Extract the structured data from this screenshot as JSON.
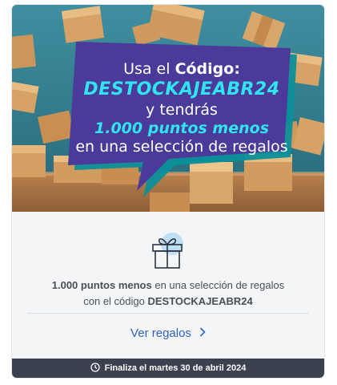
{
  "banner": {
    "line1_prefix": "Usa el ",
    "line1_bold": "Código:",
    "code": "DESTOCKAJEABR24",
    "line3": "y tendrás",
    "points": "1.000 puntos menos",
    "line5": "en una selección de regalos"
  },
  "content": {
    "desc_bold1": "1.000 puntos menos",
    "desc_text1": " en una selección de regalos",
    "desc_text2": "con el código ",
    "desc_bold2": "DESTOCKAJEABR24",
    "link_label": "Ver regalos"
  },
  "footer": {
    "text": "Finaliza el martes 30 de abril 2024"
  },
  "colors": {
    "bubble": "#4b3a9a",
    "accent": "#2fe6f0",
    "link": "#2f62c0",
    "footer_bg": "#3c4150"
  },
  "icons": [
    "gift-icon",
    "chevron-right-icon",
    "clock-icon"
  ]
}
